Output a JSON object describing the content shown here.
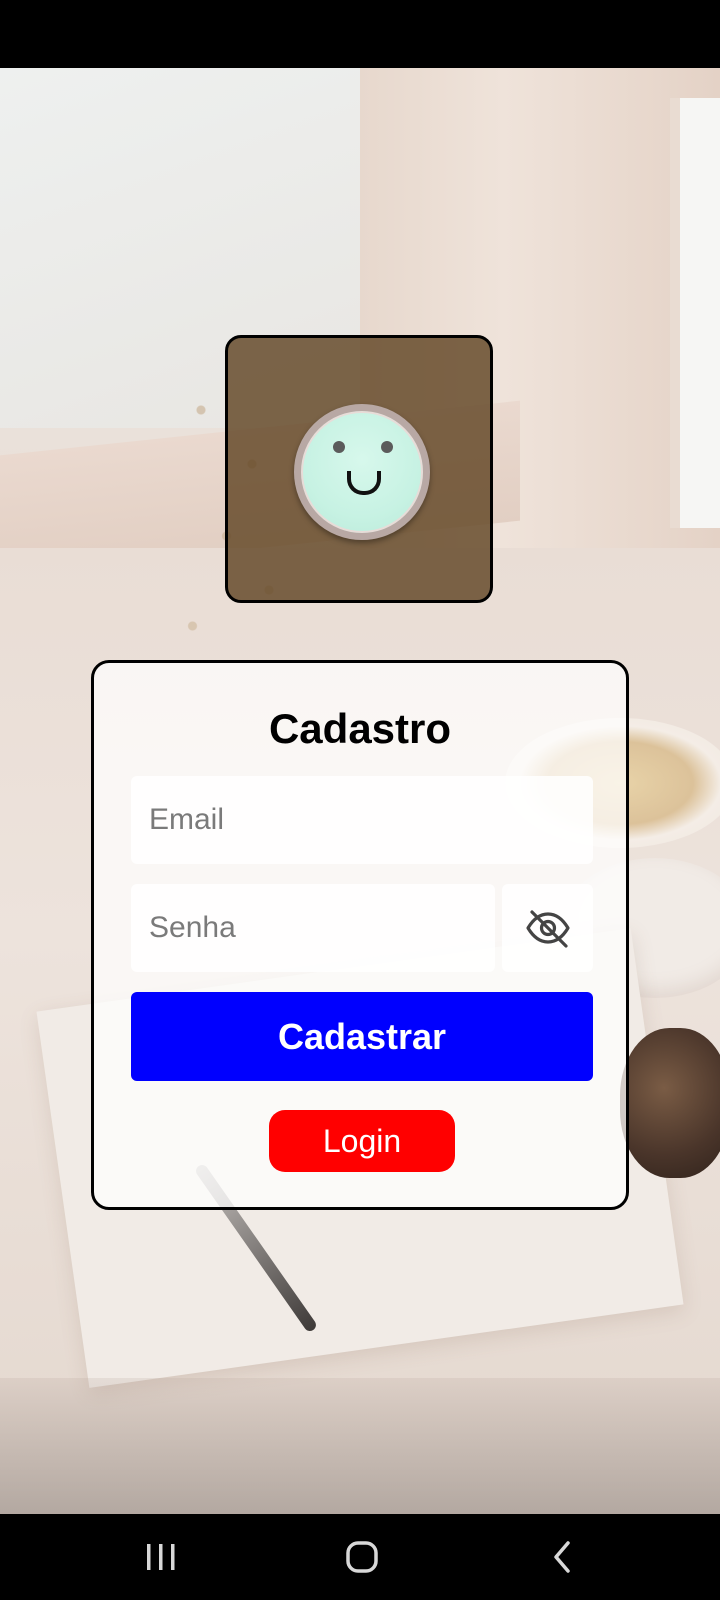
{
  "form": {
    "title": "Cadastro",
    "email_placeholder": "Email",
    "password_placeholder": "Senha",
    "submit_label": "Cadastrar",
    "login_label": "Login"
  },
  "logo": {
    "icon": "smiley-face-icon"
  },
  "password_toggle": {
    "icon": "eye-slash-icon"
  },
  "colors": {
    "submit_button": "#0000ff",
    "login_button": "#ff0000",
    "logo_box": "#624624"
  },
  "navigation": {
    "recents_icon": "recents-icon",
    "home_icon": "home-icon",
    "back_icon": "back-icon"
  }
}
